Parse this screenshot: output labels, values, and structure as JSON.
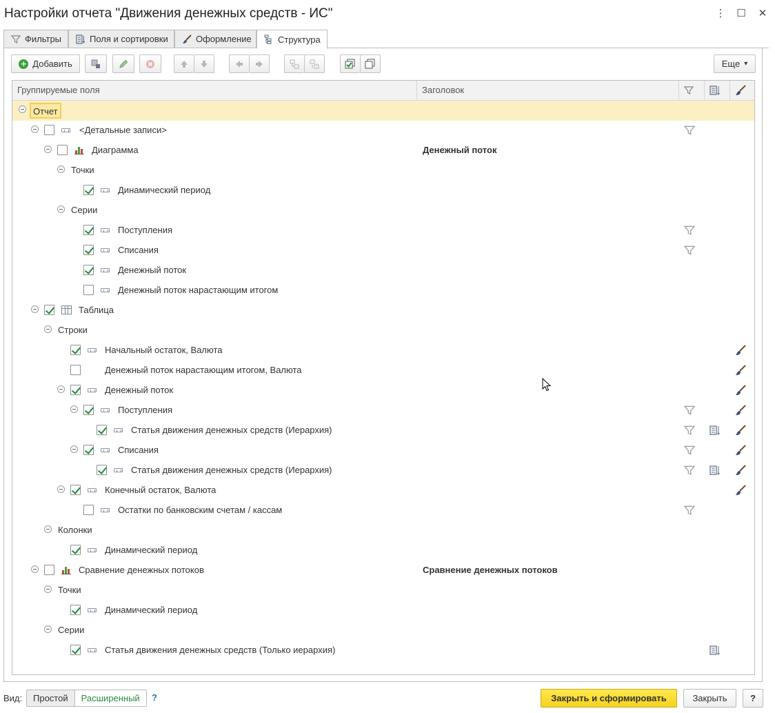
{
  "window": {
    "title": "Настройки отчета \"Движения денежных средств - ИС\"",
    "menu_glyph": "⋮",
    "maximize_glyph": "☐",
    "close_glyph": "✕"
  },
  "tabs": [
    {
      "label": "Фильтры",
      "active": false
    },
    {
      "label": "Поля и сортировки",
      "active": false
    },
    {
      "label": "Оформление",
      "active": false
    },
    {
      "label": "Структура",
      "active": true
    }
  ],
  "toolbar": {
    "add_label": "Добавить",
    "more_label": "Еще",
    "more_arrow": "▾"
  },
  "grid": {
    "columns": {
      "fields": "Группируемые поля",
      "title": "Заголовок"
    },
    "rows": {
      "r0": {
        "label": "Отчет"
      },
      "r1": {
        "label": "<Детальные записи>"
      },
      "r2": {
        "label": "Диаграмма",
        "title": "Денежный поток"
      },
      "r3": {
        "label": "Точки"
      },
      "r4": {
        "label": "Динамический период"
      },
      "r5": {
        "label": "Серии"
      },
      "r6": {
        "label": "Поступления"
      },
      "r7": {
        "label": "Списания"
      },
      "r8": {
        "label": "Денежный поток"
      },
      "r9": {
        "label": "Денежный поток нарастающим итогом"
      },
      "r10": {
        "label": "Таблица"
      },
      "r11": {
        "label": "Строки"
      },
      "r12": {
        "label": "Начальный остаток, Валюта"
      },
      "r13": {
        "label": "Денежный поток нарастающим итогом, Валюта"
      },
      "r14": {
        "label": "Денежный поток"
      },
      "r15": {
        "label": "Поступления"
      },
      "r16": {
        "label": "Статья движения денежных средств (Иерархия)"
      },
      "r17": {
        "label": "Списания"
      },
      "r18": {
        "label": "Статья движения денежных средств (Иерархия)"
      },
      "r19": {
        "label": "Конечный остаток, Валюта"
      },
      "r20": {
        "label": "Остатки по банковским счетам / кассам"
      },
      "r21": {
        "label": "Колонки"
      },
      "r22": {
        "label": "Динамический период"
      },
      "r23": {
        "label": "Сравнение денежных потоков",
        "title": "Сравнение денежных потоков"
      },
      "r24": {
        "label": "Точки"
      },
      "r25": {
        "label": "Динамический период"
      },
      "r26": {
        "label": "Серии"
      },
      "r27": {
        "label": "Статья движения денежных средств (Только иерархия)"
      }
    }
  },
  "footer": {
    "view_label": "Вид:",
    "view_simple": "Простой",
    "view_advanced": "Расширенный",
    "help_link": "?",
    "close_and_generate": "Закрыть и сформировать",
    "close": "Закрыть",
    "help_button": "?"
  },
  "colors": {
    "accent_yellow": "#f6d21d",
    "selection_row": "#fbf0c3",
    "check_green": "#1f8a3a"
  }
}
